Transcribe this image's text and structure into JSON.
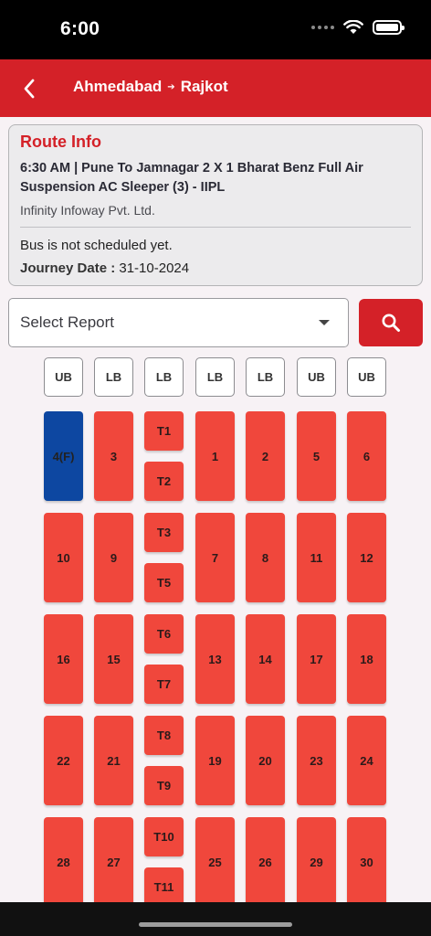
{
  "status_bar": {
    "time": "6:00"
  },
  "header": {
    "from": "Ahmedabad",
    "to": "Rajkot"
  },
  "route_info": {
    "title": "Route Info",
    "bus_details": "6:30 AM | Pune To Jamnagar 2 X 1 Bharat Benz Full Air Suspension AC Sleeper (3) - IIPL",
    "company": "Infinity Infoway Pvt. Ltd.",
    "status": "Bus is not scheduled yet.",
    "journey_date_label": "Journey Date :",
    "journey_date": "31-10-2024"
  },
  "report_select": {
    "placeholder": "Select Report"
  },
  "berth_labels": [
    "UB",
    "LB",
    "LB",
    "LB",
    "LB",
    "UB",
    "UB"
  ],
  "seat_rows": [
    [
      "4(F)",
      "3",
      "T1",
      "T2",
      "1",
      "2",
      "5",
      "6"
    ],
    [
      "10",
      "9",
      "T3",
      "T5",
      "7",
      "8",
      "11",
      "12"
    ],
    [
      "16",
      "15",
      "T6",
      "T7",
      "13",
      "14",
      "17",
      "18"
    ],
    [
      "22",
      "21",
      "T8",
      "T9",
      "19",
      "20",
      "23",
      "24"
    ],
    [
      "28",
      "27",
      "T10",
      "T11",
      "25",
      "26",
      "29",
      "30"
    ]
  ],
  "colors": {
    "brand_red": "#d42128",
    "seat_available": "#f0473c",
    "seat_booked": "#0d47a1"
  },
  "icons": {
    "back": "chevron-left-icon",
    "route_arrow": "arrow-right-icon",
    "search": "search-icon",
    "dropdown": "caret-down-icon"
  }
}
